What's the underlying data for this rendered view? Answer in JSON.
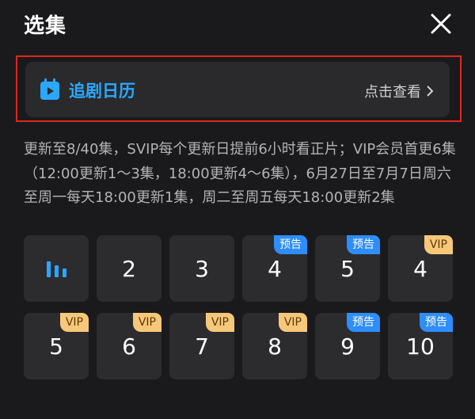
{
  "header": {
    "title": "选集"
  },
  "calendar": {
    "label": "追剧日历",
    "action": "点击查看",
    "icon": "calendar-play-icon",
    "accent_color": "#2aa8ff",
    "highlight_color": "#e0261f"
  },
  "description": "更新至8/40集，SVIP每个更新日提前6小时看正片；VIP会员首更6集（12:00更新1～3集，18:00更新4～6集），6月27日至7月7日周六至周一每天18:00更新1集，周二至周五每天18:00更新2集",
  "episodes": [
    {
      "label": "",
      "badge": "",
      "playing": true
    },
    {
      "label": "2",
      "badge": ""
    },
    {
      "label": "3",
      "badge": ""
    },
    {
      "label": "4",
      "badge": "预告",
      "badge_type": "preview"
    },
    {
      "label": "5",
      "badge": "预告",
      "badge_type": "preview"
    },
    {
      "label": "4",
      "badge": "VIP",
      "badge_type": "vip"
    },
    {
      "label": "5",
      "badge": "VIP",
      "badge_type": "vip"
    },
    {
      "label": "6",
      "badge": "VIP",
      "badge_type": "vip"
    },
    {
      "label": "7",
      "badge": "VIP",
      "badge_type": "vip"
    },
    {
      "label": "8",
      "badge": "VIP",
      "badge_type": "vip"
    },
    {
      "label": "9",
      "badge": "预告",
      "badge_type": "preview"
    },
    {
      "label": "10",
      "badge": "预告",
      "badge_type": "preview"
    }
  ],
  "colors": {
    "background": "#1a1a1c",
    "tile": "#2c2c2e",
    "preview_badge": "#2e8dff",
    "vip_badge": "#f7c77a"
  }
}
